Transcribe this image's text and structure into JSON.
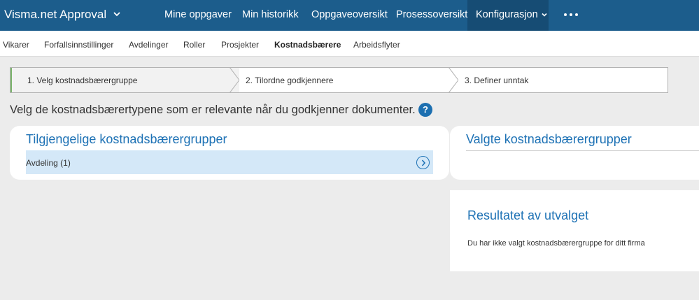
{
  "app": {
    "title": "Visma.net Approval"
  },
  "topnav": {
    "items": [
      "Mine oppgaver",
      "Min historikk",
      "Oppgaveoversikt",
      "Prosessoversikt",
      "Konfigurasjon"
    ],
    "more_icon": "more-dots-icon"
  },
  "subnav": {
    "items": [
      "Vikarer",
      "Forfallsinnstillinger",
      "Avdelinger",
      "Roller",
      "Prosjekter",
      "Kostnadsbærere",
      "Arbeidsflyter"
    ],
    "active": "Kostnadsbærere"
  },
  "wizard": {
    "steps": [
      "1. Velg kostnadsbærergruppe",
      "2. Tilordne godkjennere",
      "3. Definer unntak"
    ],
    "current_step": 1
  },
  "intro": {
    "text": "Velg de kostnadsbærertypene som er relevante når du godkjenner dokumenter.",
    "help_label": "?"
  },
  "available": {
    "title": "Tilgjengelige kostnadsbærergrupper",
    "items": [
      {
        "label": "Avdeling (1)"
      }
    ]
  },
  "selected": {
    "title": "Valgte kostnadsbærergrupper"
  },
  "result": {
    "title": "Resultatet av utvalget",
    "message": "Du har ikke valgt kostnadsbærergruppe for ditt firma"
  },
  "colors": {
    "topbar": "#1c5d8c",
    "topbar_active": "#164c74",
    "accent": "#1e72b5",
    "row_highlight": "#d4e8f8",
    "step_active_border": "#7ab56b"
  }
}
